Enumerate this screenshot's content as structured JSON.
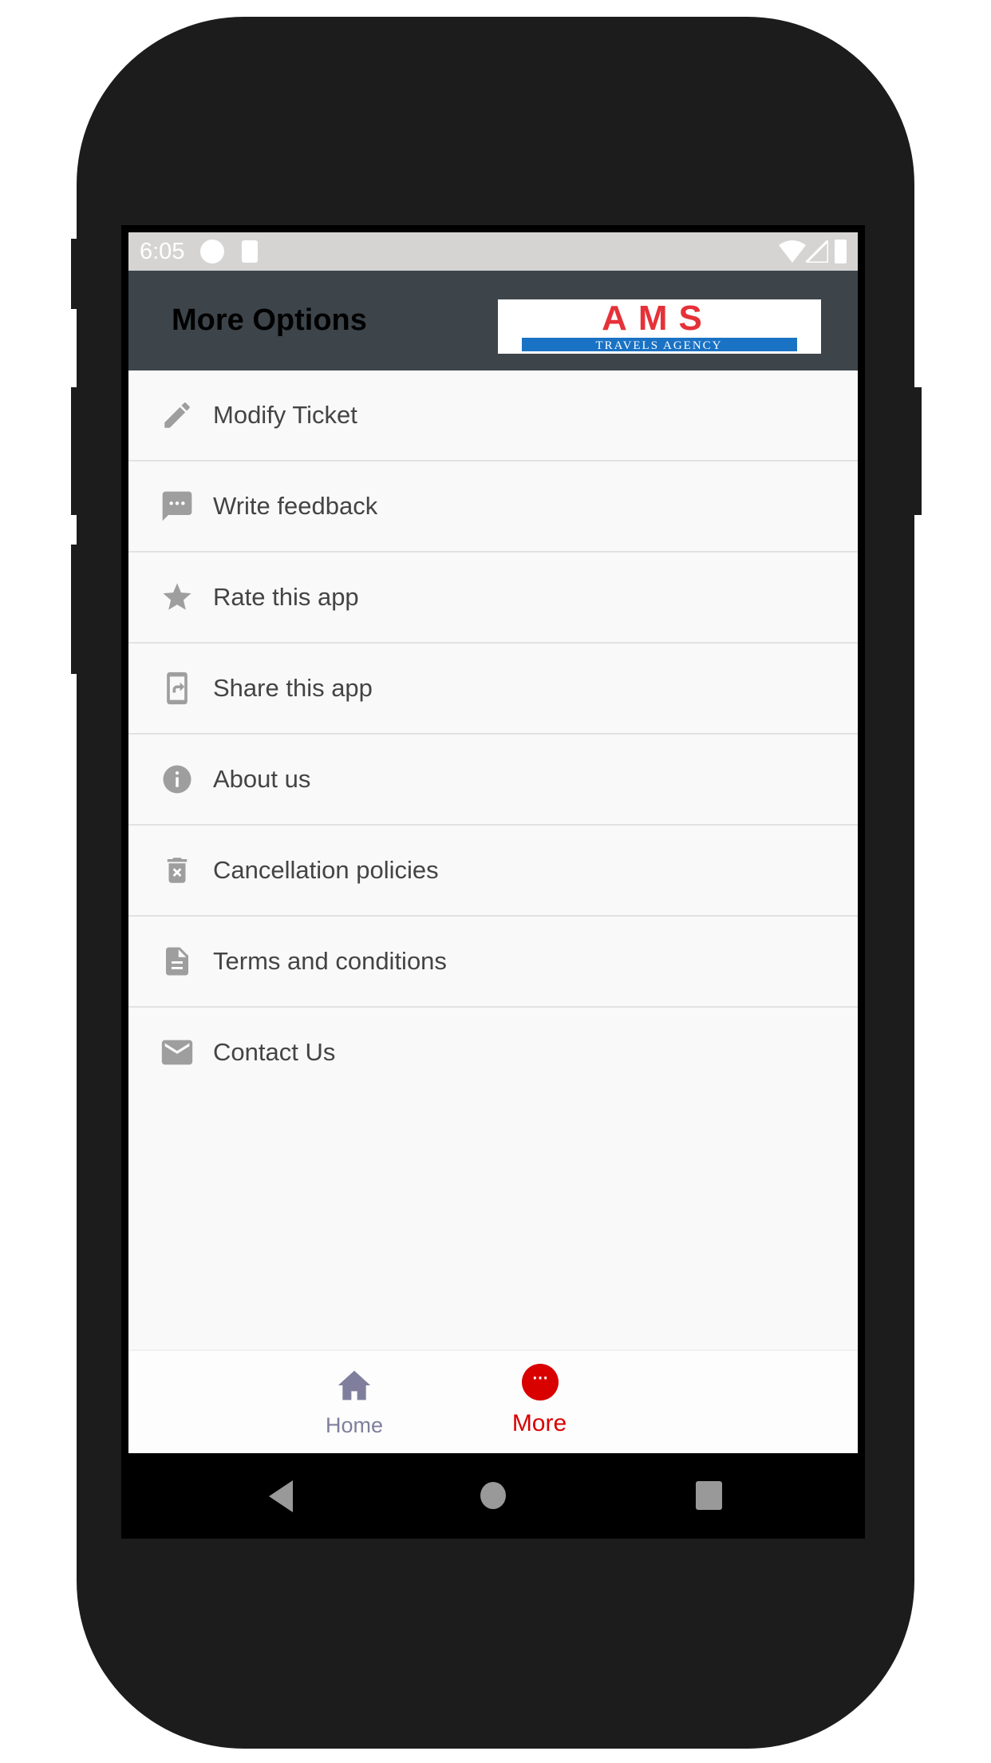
{
  "status_bar": {
    "time": "6:05"
  },
  "header": {
    "title": "More Options",
    "logo_text": "AMS TRAVELS AGENCY"
  },
  "menu": [
    {
      "label": "Modify Ticket",
      "icon": "pencil-icon"
    },
    {
      "label": "Write feedback",
      "icon": "feedback-icon"
    },
    {
      "label": "Rate this app",
      "icon": "star-icon"
    },
    {
      "label": "Share this app",
      "icon": "share-phone-icon"
    },
    {
      "label": "About us",
      "icon": "info-icon"
    },
    {
      "label": "Cancellation policies",
      "icon": "delete-icon"
    },
    {
      "label": "Terms and conditions",
      "icon": "document-icon"
    },
    {
      "label": "Contact Us",
      "icon": "mail-icon"
    }
  ],
  "bottom_nav": {
    "home": {
      "label": "Home",
      "color": "#7f7f9d"
    },
    "more": {
      "label": "More",
      "color": "#d90000",
      "active": true
    }
  }
}
